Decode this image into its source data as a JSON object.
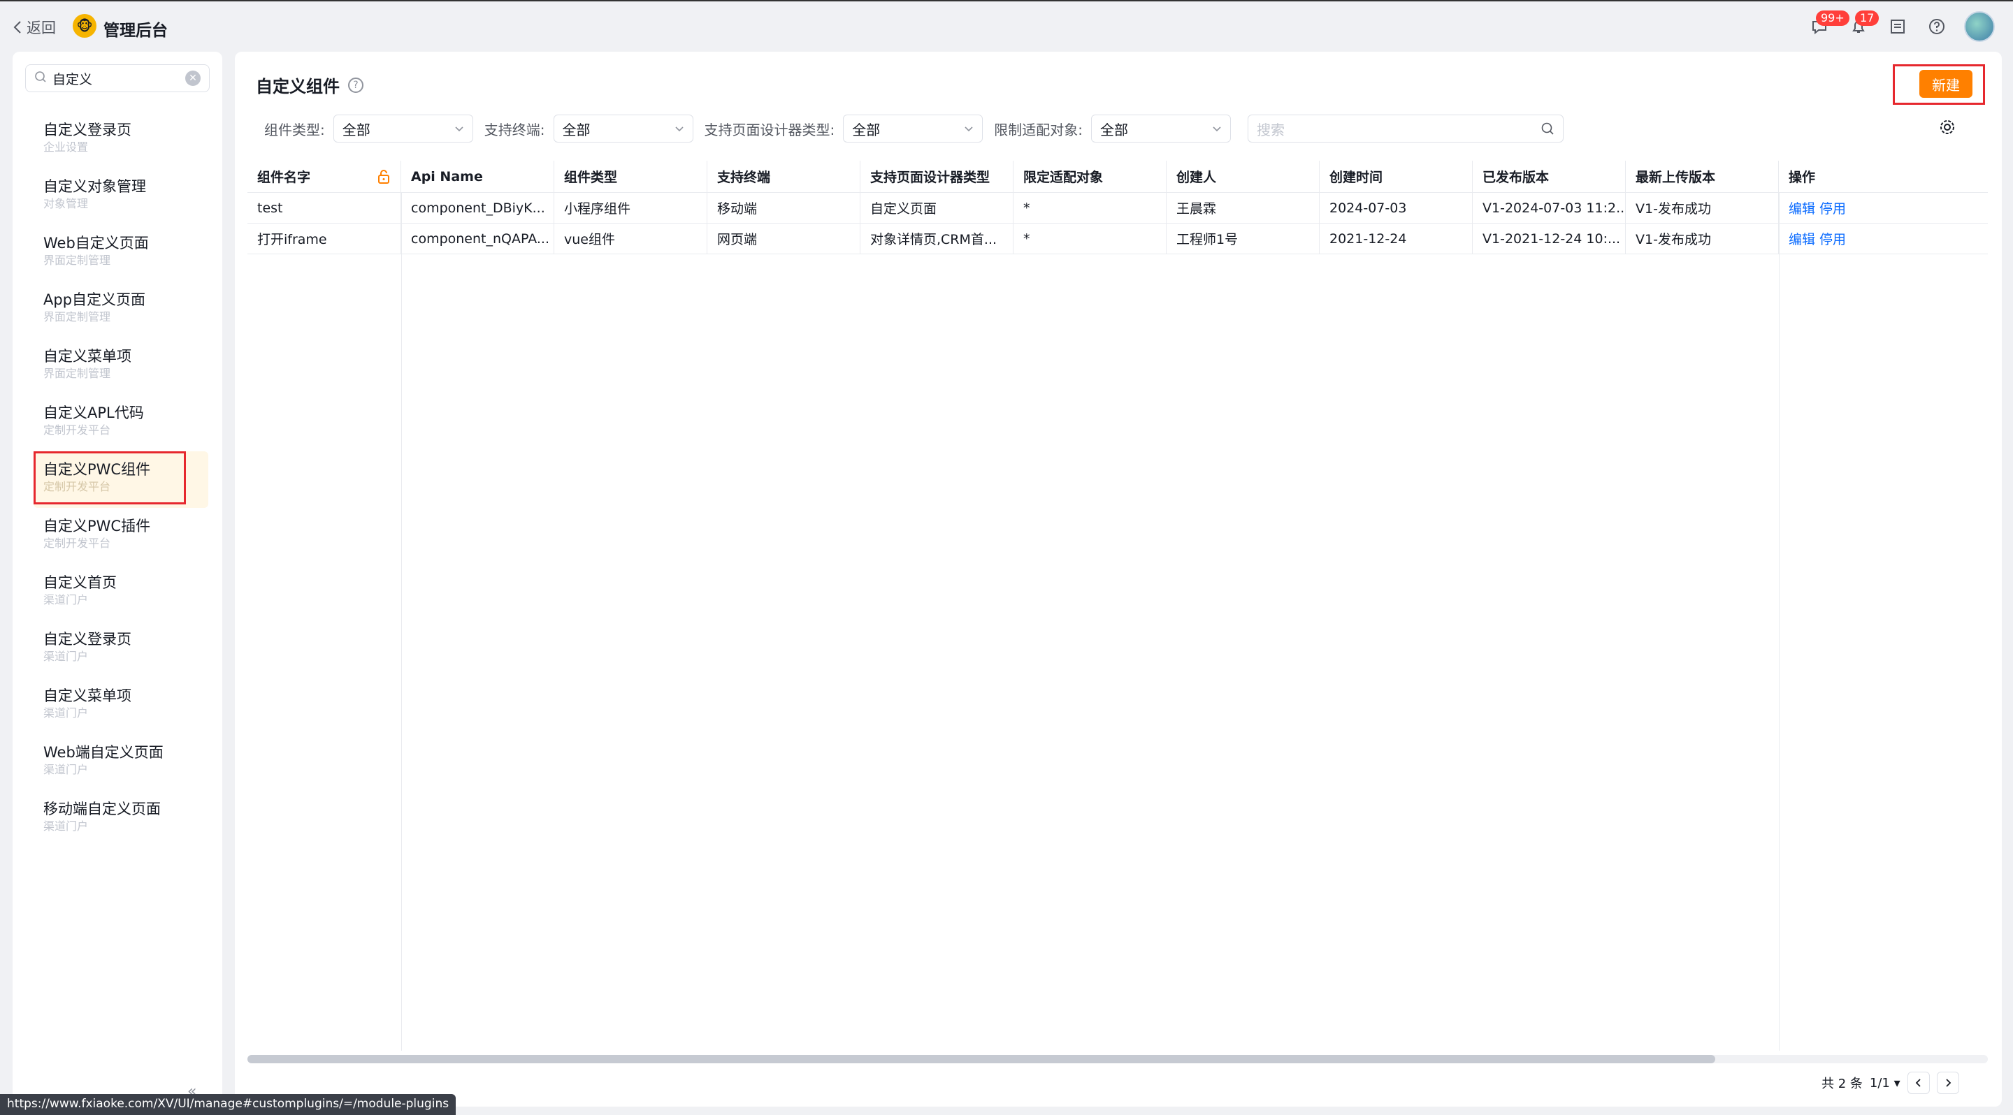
{
  "topbar": {
    "back_label": "返回",
    "app_title": "管理后台",
    "messages_badge": "99+",
    "notifications_badge": "17"
  },
  "sidebar": {
    "search_value": "自定义",
    "items": [
      {
        "label": "自定义登录页",
        "sub": "企业设置"
      },
      {
        "label": "自定义对象管理",
        "sub": "对象管理"
      },
      {
        "label": "Web自定义页面",
        "sub": "界面定制管理"
      },
      {
        "label": "App自定义页面",
        "sub": "界面定制管理"
      },
      {
        "label": "自定义菜单项",
        "sub": "界面定制管理"
      },
      {
        "label": "自定义APL代码",
        "sub": "定制开发平台"
      },
      {
        "label": "自定义PWC组件",
        "sub": "定制开发平台"
      },
      {
        "label": "自定义PWC插件",
        "sub": "定制开发平台"
      },
      {
        "label": "自定义首页",
        "sub": "渠道门户"
      },
      {
        "label": "自定义登录页",
        "sub": "渠道门户"
      },
      {
        "label": "自定义菜单项",
        "sub": "渠道门户"
      },
      {
        "label": "Web端自定义页面",
        "sub": "渠道门户"
      },
      {
        "label": "移动端自定义页面",
        "sub": "渠道门户"
      }
    ],
    "active_index": 6,
    "collapse_glyph": "«"
  },
  "status_url": "https://www.fxiaoke.com/XV/UI/manage#customplugins/=/module-plugins",
  "main": {
    "title": "自定义组件",
    "new_button": "新建",
    "filters": [
      {
        "label": "组件类型:",
        "value": "全部"
      },
      {
        "label": "支持终端:",
        "value": "全部"
      },
      {
        "label": "支持页面设计器类型:",
        "value": "全部"
      },
      {
        "label": "限制适配对象:",
        "value": "全部"
      }
    ],
    "search_placeholder": "搜索"
  },
  "table": {
    "columns": [
      "组件名字",
      "Api Name",
      "组件类型",
      "支持终端",
      "支持页面设计器类型",
      "限定适配对象",
      "创建人",
      "创建时间",
      "已发布版本",
      "最新上传版本",
      "操作"
    ],
    "rows": [
      [
        "test",
        "component_DBiyK...",
        "小程序组件",
        "移动端",
        "自定义页面",
        "*",
        "王晨霖",
        "2024-07-03",
        "V1-2024-07-03 11:2...",
        "V1-发布成功"
      ],
      [
        "打开iframe",
        "component_nQAPA...",
        "vue组件",
        "网页端",
        "对象详情页,CRM首...",
        "*",
        "工程师1号",
        "2021-12-24",
        "V1-2021-12-24 10:...",
        "V1-发布成功"
      ]
    ],
    "actions": [
      "编辑",
      "停用"
    ]
  },
  "pager": {
    "total": "共 2 条",
    "page": "1/1"
  },
  "colors": {
    "accent": "#ff8000",
    "link": "#0c6cff",
    "highlight_border": "#e6282e",
    "active_bg": "#fff7e6"
  }
}
